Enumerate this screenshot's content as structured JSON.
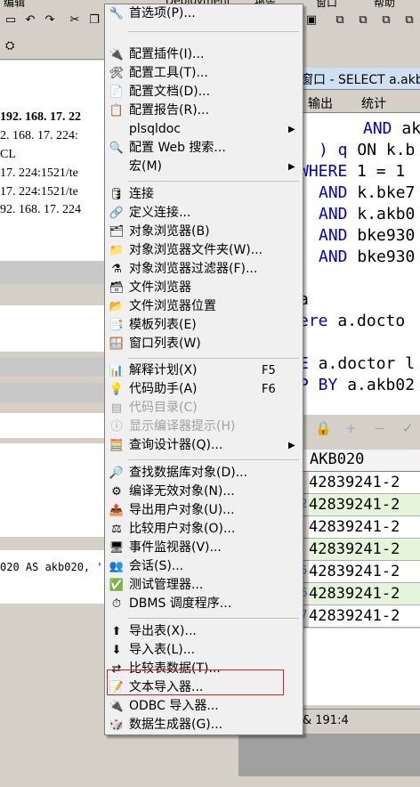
{
  "menubar": {
    "left_fragment": "编辑",
    "right_fragments": [
      "Deployment",
      "报告",
      "窗口",
      "帮助"
    ]
  },
  "left_panel": {
    "tree_lines": [
      "192. 168. 17. 22",
      "2. 168. 17. 224:",
      "CL",
      "17. 224:1521/te",
      "17. 224:1521/te",
      "92. 168. 17. 224"
    ],
    "sql_fragment": "020 AS akb020, '"
  },
  "editor": {
    "tab_title": "窗口 - SELECT a.akb",
    "tabs": [
      "输出",
      "统计"
    ],
    "sql_lines": [
      {
        "kw": "AND",
        "rest": " ak"
      },
      {
        "kw": ") q",
        "rest": " ON k.b"
      },
      {
        "kw": "WHERE",
        "rest": " 1 = 1"
      },
      {
        "kw": "AND",
        "rest": " k.bke7"
      },
      {
        "kw": "AND",
        "rest": " k.akb0"
      },
      {
        "kw": "AND",
        "rest": " bke930"
      },
      {
        "kw": "AND",
        "rest": " bke930"
      },
      {
        "kw": "a",
        "rest": ""
      },
      {
        "kw": "ere",
        "rest": "  a.docto"
      },
      {
        "kw": "E",
        "rest": " a.doctor l"
      },
      {
        "kw": "P BY",
        "rest": " a.akb02"
      }
    ],
    "grid_header": "AKB020",
    "grid_rows": [
      "42839241-2",
      "42839241-2",
      "42839241-2",
      "42839241-2",
      "42839241-2",
      "42839241-2",
      "42839241-2"
    ],
    "status": "&  191:4"
  },
  "menu": {
    "items": [
      {
        "icon": "wrench-icon",
        "glyph": "🔧",
        "label": "首选项(P)...",
        "enabled": true
      },
      {
        "sep": true
      },
      {
        "icon": "plugin-icon",
        "glyph": "🔌",
        "label": "配置插件(I)...",
        "enabled": true
      },
      {
        "icon": "tools-icon",
        "glyph": "🛠",
        "label": "配置工具(T)...",
        "enabled": true
      },
      {
        "icon": "document-icon",
        "glyph": "📄",
        "label": "配置文档(D)...",
        "enabled": true
      },
      {
        "icon": "report-icon",
        "glyph": "📋",
        "label": "配置报告(R)...",
        "enabled": true
      },
      {
        "icon": "",
        "glyph": "",
        "label": "plsqldoc",
        "enabled": true,
        "submenu": true
      },
      {
        "icon": "web-search-icon",
        "glyph": "🔍",
        "label": "配置 Web 搜索...",
        "enabled": true
      },
      {
        "icon": "",
        "glyph": "",
        "label": "宏(M)",
        "enabled": true,
        "submenu": true
      },
      {
        "sep": true
      },
      {
        "icon": "database-icon",
        "glyph": "🛢",
        "label": "连接",
        "enabled": true
      },
      {
        "icon": "define-connection-icon",
        "glyph": "🔗",
        "label": "定义连接...",
        "enabled": true
      },
      {
        "icon": "object-browser-icon",
        "glyph": "🗂",
        "label": "对象浏览器(B)",
        "enabled": true
      },
      {
        "icon": "object-browser-folder-icon",
        "glyph": "📁",
        "label": "对象浏览器文件夹(W)...",
        "enabled": true
      },
      {
        "icon": "object-browser-filter-icon",
        "glyph": "⚗",
        "label": "对象浏览器过滤器(F)...",
        "enabled": true
      },
      {
        "icon": "file-browser-icon",
        "glyph": "🗃",
        "label": "文件浏览器",
        "enabled": true
      },
      {
        "icon": "file-browser-location-icon",
        "glyph": "📂",
        "label": "文件浏览器位置",
        "enabled": true
      },
      {
        "icon": "template-list-icon",
        "glyph": "📑",
        "label": "模板列表(E)",
        "enabled": true
      },
      {
        "icon": "window-list-icon",
        "glyph": "🪟",
        "label": "窗口列表(W)",
        "enabled": true
      },
      {
        "sep": true
      },
      {
        "icon": "explain-plan-icon",
        "glyph": "📊",
        "label": "解释计划(X)",
        "shortcut": "F5",
        "enabled": true
      },
      {
        "icon": "code-assistant-icon",
        "glyph": "💡",
        "label": "代码助手(A)",
        "shortcut": "F6",
        "enabled": true
      },
      {
        "icon": "code-contents-icon",
        "glyph": "▤",
        "label": "代码目录(C)",
        "enabled": false
      },
      {
        "icon": "compiler-hints-icon",
        "glyph": "ⓘ",
        "label": "显示编译器提示(H)",
        "enabled": false
      },
      {
        "icon": "query-designer-icon",
        "glyph": "🧮",
        "label": "查询设计器(Q)...",
        "enabled": true,
        "submenu": true
      },
      {
        "sep": true
      },
      {
        "icon": "find-db-objects-icon",
        "glyph": "🔎",
        "label": "查找数据库对象(D)...",
        "enabled": true
      },
      {
        "icon": "compile-invalid-icon",
        "glyph": "⚙",
        "label": "编译无效对象(N)...",
        "enabled": true
      },
      {
        "icon": "export-user-objects-icon",
        "glyph": "📤",
        "label": "导出用户对象(U)...",
        "enabled": true
      },
      {
        "icon": "compare-user-objects-icon",
        "glyph": "⚖",
        "label": "比较用户对象(O)...",
        "enabled": true
      },
      {
        "icon": "event-monitor-icon",
        "glyph": "🖥",
        "label": "事件监视器(V)...",
        "enabled": true
      },
      {
        "icon": "sessions-icon",
        "glyph": "👥",
        "label": "会话(S)...",
        "enabled": true
      },
      {
        "icon": "test-manager-icon",
        "glyph": "✅",
        "label": "测试管理器...",
        "enabled": true
      },
      {
        "icon": "dbms-scheduler-icon",
        "glyph": "⏱",
        "label": "DBMS 调度程序...",
        "enabled": true
      },
      {
        "sep": true
      },
      {
        "icon": "export-tables-icon",
        "glyph": "⬆",
        "label": "导出表(X)...",
        "enabled": true
      },
      {
        "icon": "import-tables-icon",
        "glyph": "⬇",
        "label": "导入表(L)...",
        "enabled": true
      },
      {
        "icon": "compare-table-data-icon",
        "glyph": "⇄",
        "label": "比较表数据(T)...",
        "enabled": true
      },
      {
        "icon": "text-importer-icon",
        "glyph": "📝",
        "label": "文本导入器...",
        "enabled": true,
        "highlighted": true
      },
      {
        "icon": "odbc-importer-icon",
        "glyph": "🔌",
        "label": "ODBC 导入器...",
        "enabled": true
      },
      {
        "icon": "data-generator-icon",
        "glyph": "🎲",
        "label": "数据生成器(G)...",
        "enabled": true
      }
    ]
  }
}
